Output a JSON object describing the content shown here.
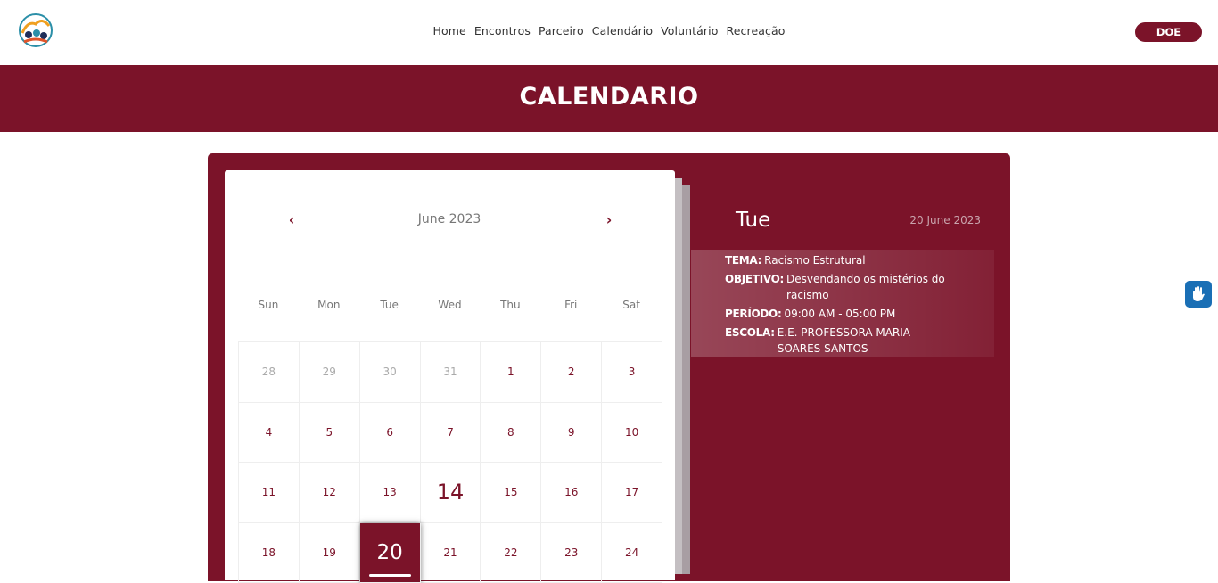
{
  "nav": [
    "Home",
    "Encontros",
    "Parceiro",
    "Calendário",
    "Voluntário",
    "Recreação"
  ],
  "header": {
    "cta_label": "DOE"
  },
  "banner": {
    "title": "CALENDARIO"
  },
  "calendar": {
    "prev_icon": "chevron-left",
    "next_icon": "chevron-right",
    "month_label": "June 2023",
    "weekdays": [
      "Sun",
      "Mon",
      "Tue",
      "Wed",
      "Thu",
      "Fri",
      "Sat"
    ],
    "days": [
      {
        "label": "28",
        "muted": true
      },
      {
        "label": "29",
        "muted": true
      },
      {
        "label": "30",
        "muted": true
      },
      {
        "label": "31",
        "muted": true
      },
      {
        "label": "1"
      },
      {
        "label": "2"
      },
      {
        "label": "3"
      },
      {
        "label": "4"
      },
      {
        "label": "5"
      },
      {
        "label": "6"
      },
      {
        "label": "7"
      },
      {
        "label": "8"
      },
      {
        "label": "9"
      },
      {
        "label": "10"
      },
      {
        "label": "11"
      },
      {
        "label": "12"
      },
      {
        "label": "13"
      },
      {
        "label": "14",
        "today": true
      },
      {
        "label": "15"
      },
      {
        "label": "16"
      },
      {
        "label": "17"
      },
      {
        "label": "18"
      },
      {
        "label": "19"
      },
      {
        "label": "20",
        "selected": true
      },
      {
        "label": "21"
      },
      {
        "label": "22"
      },
      {
        "label": "23"
      },
      {
        "label": "24"
      }
    ]
  },
  "details": {
    "day_name": "Tue",
    "date_label": "20 June 2023",
    "fields": [
      {
        "label": "TEMA:",
        "value": "Racismo Estrutural"
      },
      {
        "label": "OBJETIVO:",
        "value": "Desvendando os mistérios do racismo"
      },
      {
        "label": "PERÍODO:",
        "value": "09:00 AM - 05:00 PM"
      },
      {
        "label": "ESCOLA:",
        "value": "E.E. PROFESSORA MARIA SOARES SANTOS"
      }
    ]
  },
  "colors": {
    "brand": "#7b1329",
    "accessibility": "#1a6fb5"
  },
  "icons": {
    "logo": "community-logo",
    "accessibility": "sign-language-icon"
  }
}
